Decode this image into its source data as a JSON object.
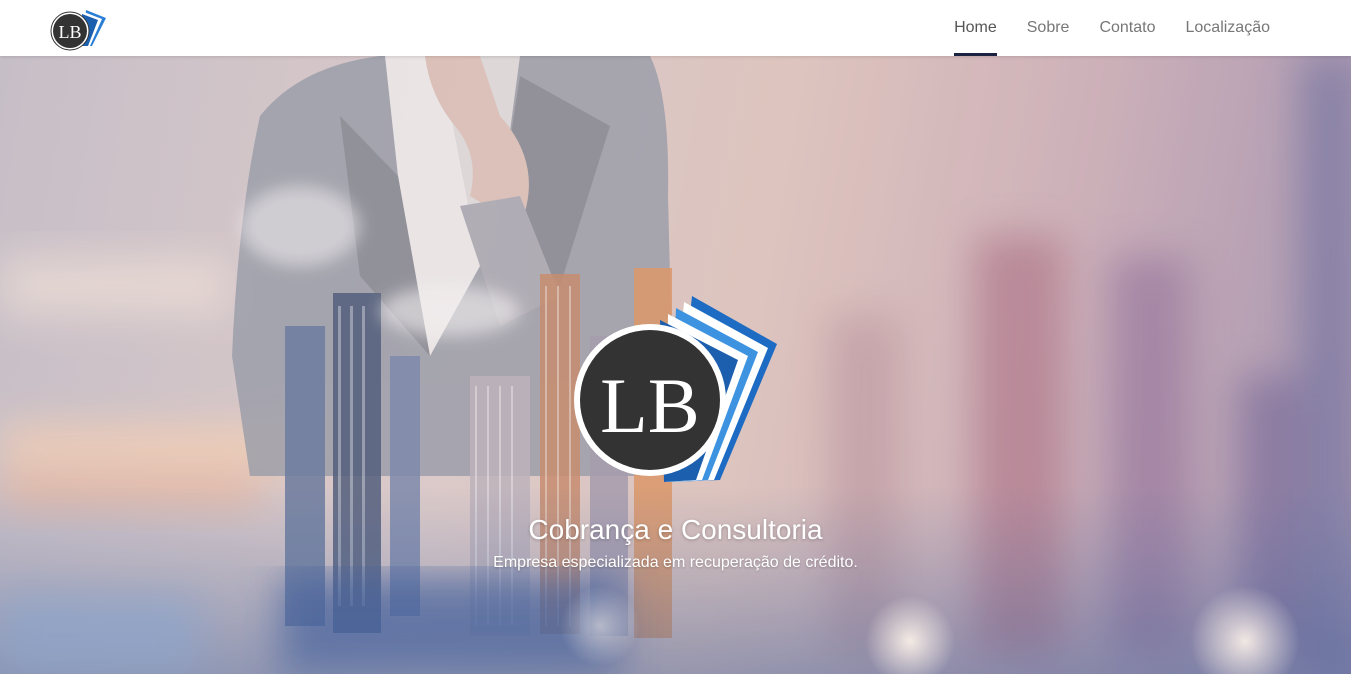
{
  "brand": {
    "logo_initials": "LB",
    "logo_icon": "lb-book-logo-icon",
    "colors": {
      "logo_dark": "#333333",
      "logo_blue": "#2a7fd4",
      "logo_navy": "#1c2340",
      "nav_active_underline": "#1c2340"
    }
  },
  "nav": {
    "items": [
      {
        "label": "Home",
        "active": true
      },
      {
        "label": "Sobre",
        "active": false
      },
      {
        "label": "Contato",
        "active": false
      },
      {
        "label": "Localização",
        "active": false
      }
    ]
  },
  "hero": {
    "title": "Cobrança e Consultoria",
    "subtitle": "Empresa especializada em recuperação de crédito."
  }
}
